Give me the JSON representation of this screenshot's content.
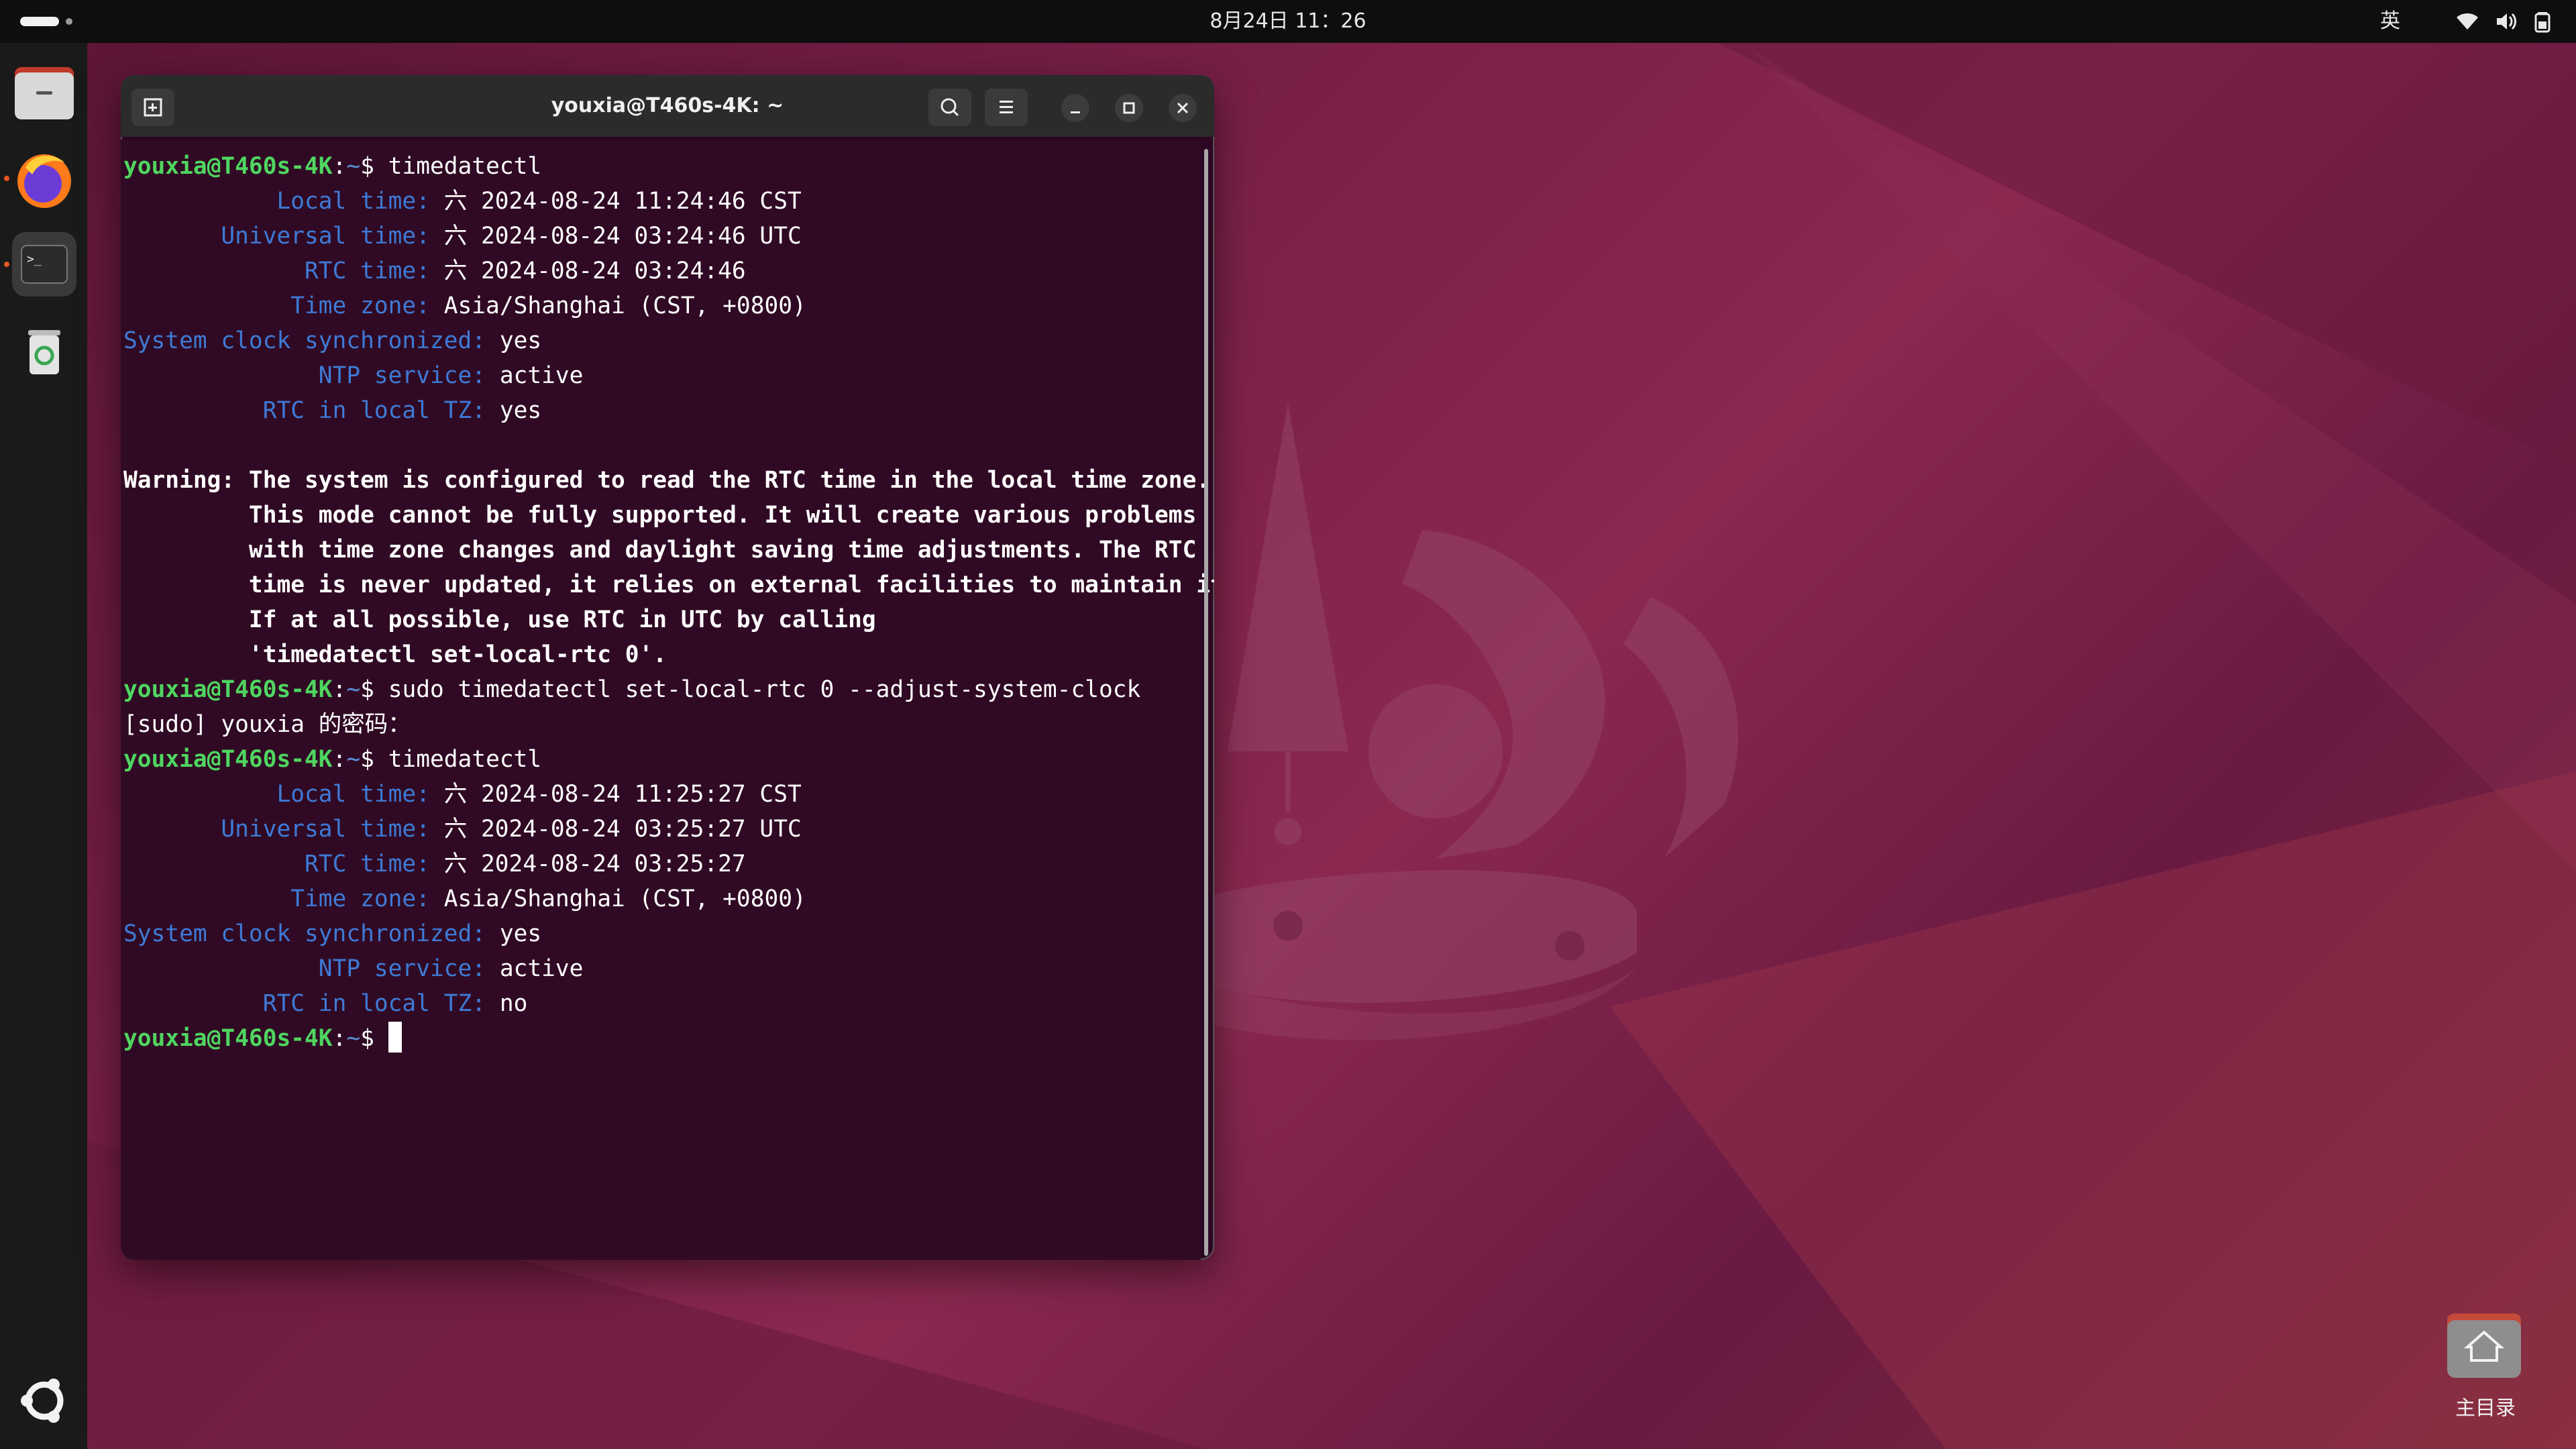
{
  "topbar": {
    "clock": "8月24日 11：26",
    "input_method": "英",
    "icons": [
      "wifi-icon",
      "volume-icon",
      "battery-icon"
    ]
  },
  "dock": {
    "items": [
      "files-icon",
      "firefox-icon",
      "terminal-icon",
      "trash-icon",
      "show-apps-icon"
    ]
  },
  "terminal": {
    "title": "youxia@T460s-4K: ~",
    "prompt": "youxia@T460s-4K",
    "prompt_path": "~",
    "prompt_symbol": "$",
    "commands": {
      "c1": "timedatectl",
      "c2": "sudo timedatectl set-local-rtc 0 --adjust-system-clock",
      "c3": "timedatectl"
    },
    "block1": {
      "local_time_label": "Local time:",
      "local_time": "六 2024-08-24 11:24:46 CST",
      "universal_time_label": "Universal time:",
      "universal_time": "六 2024-08-24 03:24:46 UTC",
      "rtc_time_label": "RTC time:",
      "rtc_time": "六 2024-08-24 03:24:46",
      "time_zone_label": "Time zone:",
      "time_zone": "Asia/Shanghai (CST, +0800)",
      "sync_label": "System clock synchronized:",
      "sync": "yes",
      "ntp_label": "NTP service:",
      "ntp": "active",
      "rtc_local_label": "RTC in local TZ:",
      "rtc_local": "yes"
    },
    "warning": [
      "Warning: The system is configured to read the RTC time in the local time zone.",
      "         This mode cannot be fully supported. It will create various problems",
      "         with time zone changes and daylight saving time adjustments. The RTC",
      "         time is never updated, it relies on external facilities to maintain it.",
      "         If at all possible, use RTC in UTC by calling",
      "         'timedatectl set-local-rtc 0'."
    ],
    "sudo_prompt": "[sudo] youxia 的密码：",
    "block2": {
      "local_time_label": "Local time:",
      "local_time": "六 2024-08-24 11:25:27 CST",
      "universal_time_label": "Universal time:",
      "universal_time": "六 2024-08-24 03:25:27 UTC",
      "rtc_time_label": "RTC time:",
      "rtc_time": "六 2024-08-24 03:25:27",
      "time_zone_label": "Time zone:",
      "time_zone": "Asia/Shanghai (CST, +0800)",
      "sync_label": "System clock synchronized:",
      "sync": "yes",
      "ntp_label": "NTP service:",
      "ntp": "active",
      "rtc_local_label": "RTC in local TZ:",
      "rtc_local": "no"
    }
  },
  "desktop": {
    "home_label": "主目录"
  },
  "colors": {
    "terminal_bg": "#300a24",
    "prompt_green": "#4fd660",
    "label_blue": "#3e7ad6",
    "accent_orange": "#e95420"
  }
}
